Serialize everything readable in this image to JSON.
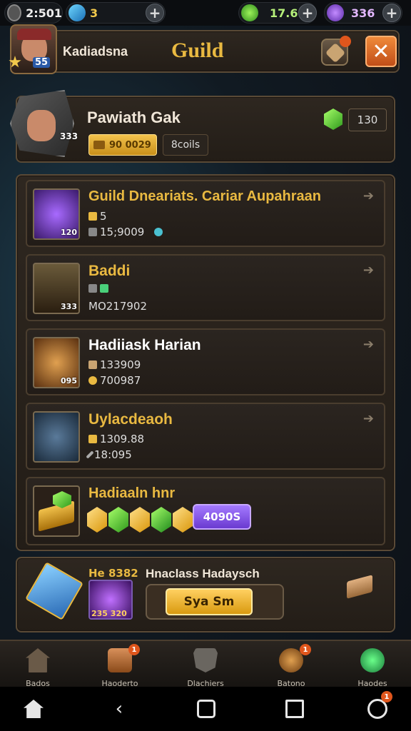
{
  "resources": {
    "time": "2:501",
    "gems": "3",
    "energy": "17.6",
    "crystals": "336"
  },
  "header": {
    "player_name": "Kadiadsna",
    "player_level": "55",
    "title": "Guild"
  },
  "guild_card": {
    "name": "Pawiath Gak",
    "level_badge": "333",
    "gold": "90 0029",
    "coins": "8coils",
    "gem_count": "130"
  },
  "list": [
    {
      "title": "Guild Dneariats. Cariar Aupahraan",
      "line1": "5",
      "line2": "15;9009",
      "thumb_label": "120",
      "title_color": "#e9b941"
    },
    {
      "title": "Baddi",
      "line1": "",
      "line2": "MO217902",
      "thumb_label": "333",
      "title_color": "#e9b941"
    },
    {
      "title": "Hadiiask Harian",
      "line1": "133909",
      "line2": "700987",
      "thumb_label": "095",
      "title_color": "#ffffff"
    },
    {
      "title": "Uylacdeaoh",
      "line1": "1309.88",
      "line2": "18:095",
      "thumb_label": "",
      "title_color": "#e9b941"
    }
  ],
  "chest_row": {
    "title": "Hadiaaln hnr",
    "price": "4090S"
  },
  "bottom_card": {
    "label": "He 8382",
    "title": "Hnaclass Hadaysch",
    "hero_label": "235 320",
    "button_label": "Sya Sm"
  },
  "nav": [
    {
      "label": "Bados",
      "icon": "home-icon"
    },
    {
      "label": "Haoderto",
      "icon": "quest-icon",
      "badge": "1"
    },
    {
      "label": "Dlachiers",
      "icon": "shield-icon"
    },
    {
      "label": "Batono",
      "icon": "compass-icon",
      "badge": "1"
    },
    {
      "label": "Haodes",
      "icon": "orb-icon"
    }
  ],
  "system_badge": "1",
  "colors": {
    "gold": "#e9b941",
    "close_btn": "#e0702a",
    "purple_btn": "#8a5cf0",
    "accent_orange": "#e0561c"
  }
}
